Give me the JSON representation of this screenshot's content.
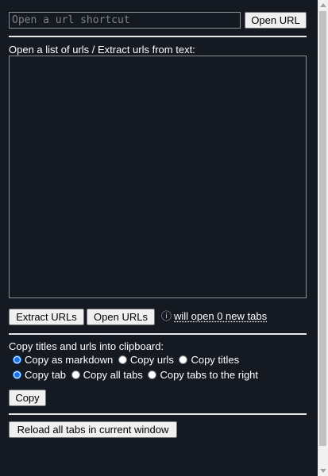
{
  "url_shortcut": {
    "placeholder": "Open a url shortcut",
    "value": "",
    "open_button": "Open URL"
  },
  "list_section": {
    "label": "Open a list of urls / Extract urls from text:",
    "textarea_value": "",
    "extract_button": "Extract URLs",
    "open_button": "Open URLs",
    "info_icon": "ⓘ",
    "info_text": "will open 0 new tabs"
  },
  "clipboard_section": {
    "label": "Copy titles and urls into clipboard:",
    "format_options": [
      {
        "label": "Copy as markdown",
        "checked": true
      },
      {
        "label": "Copy urls",
        "checked": false
      },
      {
        "label": "Copy titles",
        "checked": false
      }
    ],
    "scope_options": [
      {
        "label": "Copy tab",
        "checked": true
      },
      {
        "label": "Copy all tabs",
        "checked": false
      },
      {
        "label": "Copy tabs to the right",
        "checked": false
      }
    ],
    "copy_button": "Copy"
  },
  "reload_section": {
    "reload_button": "Reload all tabs in current window"
  },
  "colors": {
    "background": "#151921",
    "text": "#ffffff",
    "radio_accent": "#1a73e8"
  }
}
